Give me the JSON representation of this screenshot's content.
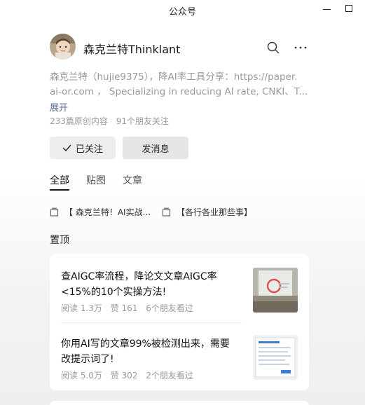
{
  "window": {
    "title": "公众号"
  },
  "profile": {
    "name": "森克兰特Thinklant"
  },
  "description": {
    "line1": "森克兰特（hujie9375），降AI率工具分享：https://paper.",
    "line2": "ai-or.com ， Specializing in reducing AI rate, CNKI、T...",
    "expand_label": "展开"
  },
  "stats": {
    "original": "233篇原创内容",
    "friends": "91个朋友关注"
  },
  "actions": {
    "follow_label": "已关注",
    "message_label": "发消息"
  },
  "tabs": [
    {
      "label": "全部",
      "active": true
    },
    {
      "label": "贴图",
      "active": false
    },
    {
      "label": "文章",
      "active": false
    }
  ],
  "collections": [
    {
      "label": "【 森克兰特！AI实战..."
    },
    {
      "label": "【各行各业那些事】"
    }
  ],
  "pinned_label": "置顶",
  "articles": [
    {
      "title": "查AIGC率流程，降论文文章AIGC率<15%的10个实操方法!",
      "reads": "阅读 1.3万",
      "likes": "赞 161",
      "friends": "6个朋友看过"
    },
    {
      "title": "你用AI写的文章99%被检测出来，需要改提示词了!",
      "reads": "阅读 5.0万",
      "likes": "赞 302",
      "friends": "2个朋友看过"
    }
  ],
  "colors": {
    "link": "#576b95",
    "muted": "#9a9a9a",
    "button_bg": "#ededed"
  }
}
